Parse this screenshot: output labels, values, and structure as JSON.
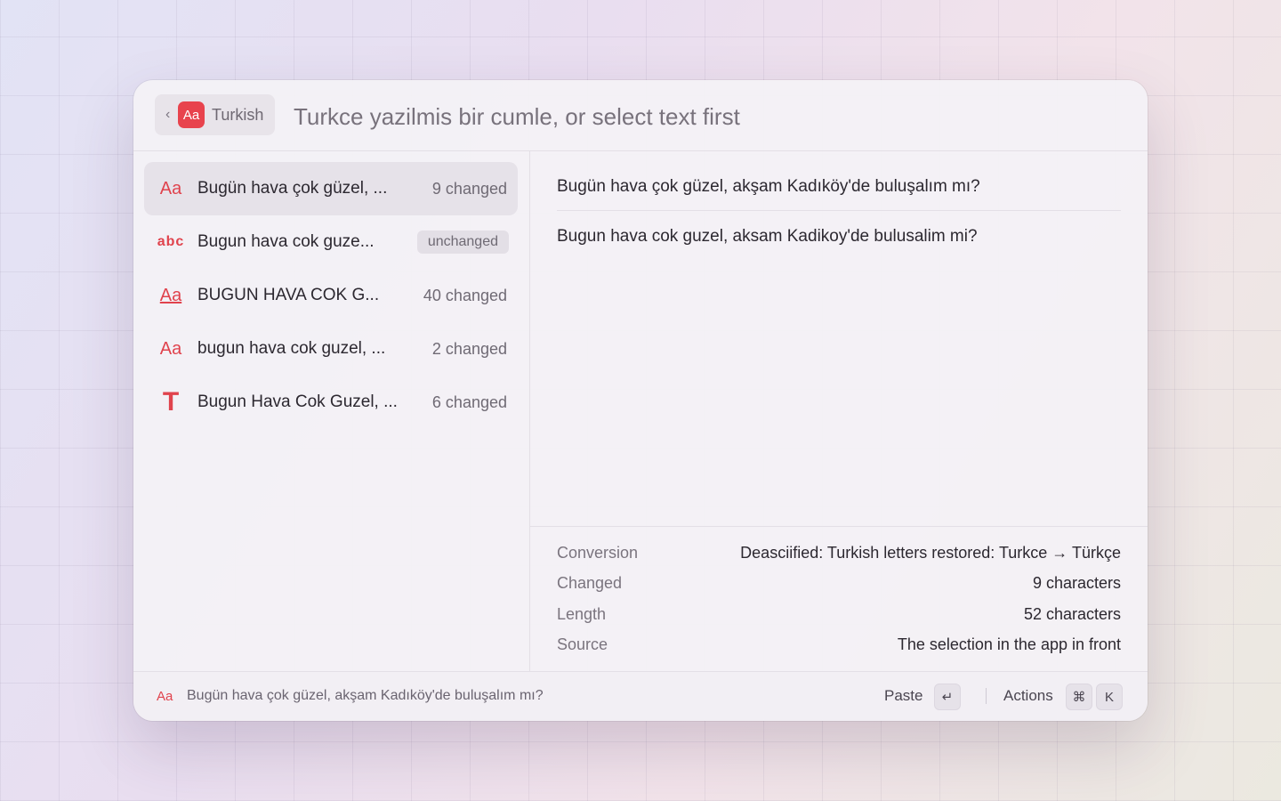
{
  "header": {
    "back_icon": "chevron-left-icon",
    "lang_badge": "Aa",
    "lang_label": "Turkish",
    "search_placeholder": "Turkce yazilmis bir cumle, or select text first",
    "search_value": ""
  },
  "results": [
    {
      "icon": "Aa",
      "icon_name": "deasciify-icon",
      "title": "Bugün hava çok güzel, ...",
      "meta": "9 changed",
      "selected": true
    },
    {
      "icon": "abc",
      "icon_name": "ascii-icon",
      "title": "Bugun hava cok guze...",
      "meta": "unchanged",
      "selected": false
    },
    {
      "icon": "Aa",
      "icon_name": "uppercase-icon",
      "title": "BUGUN HAVA COK G...",
      "meta": "40 changed",
      "selected": false
    },
    {
      "icon": "Aa",
      "icon_name": "lowercase-icon",
      "title": "bugun hava cok guzel, ...",
      "meta": "2 changed",
      "selected": false
    },
    {
      "icon": "T",
      "icon_name": "title-case-icon",
      "title": "Bugun Hava Cok Guzel, ...",
      "meta": "6 changed",
      "selected": false
    }
  ],
  "detail": {
    "converted": "Bugün hava çok güzel, akşam Kadıköy'de buluşalım mı?",
    "original": "Bugun hava cok guzel, aksam Kadikoy'de bulusalim mi?",
    "metadata": [
      {
        "key": "Conversion",
        "value": "Deasciified: Turkish letters restored: Turkce → Türkçe"
      },
      {
        "key": "Changed",
        "value": "9 characters"
      },
      {
        "key": "Length",
        "value": "52 characters"
      },
      {
        "key": "Source",
        "value": "The selection in the app in front"
      }
    ]
  },
  "footer": {
    "icon": "Aa",
    "preview": "Bugün hava çok güzel, akşam Kadıköy'de buluşalım mı?",
    "paste_label": "Paste",
    "paste_key": "↵",
    "actions_label": "Actions",
    "actions_key_1": "⌘",
    "actions_key_2": "K"
  },
  "colors": {
    "accent": "#e8434d"
  }
}
